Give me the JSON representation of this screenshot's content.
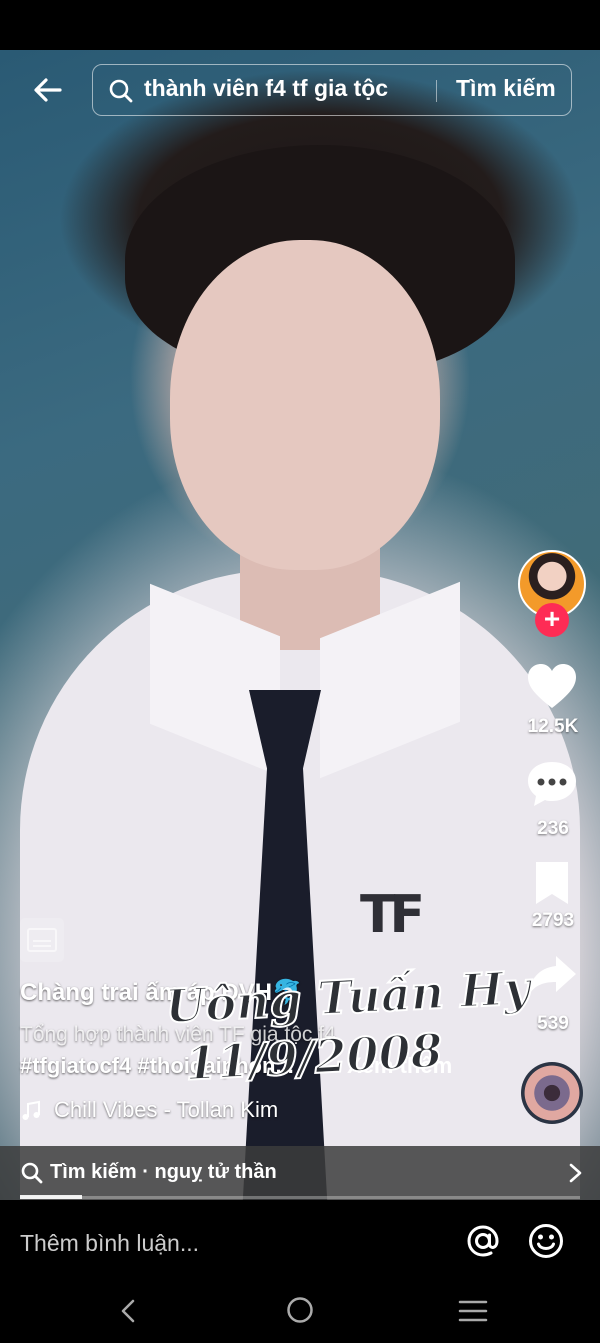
{
  "search": {
    "query": "thành viên f4 tf gia tộc",
    "button_label": "Tìm kiếm"
  },
  "actions": {
    "likes": "12.5K",
    "comments": "236",
    "saves": "2793",
    "shares": "539",
    "follow_symbol": "+"
  },
  "video": {
    "author": "Chàng trai ấm áp DVH🐬",
    "description": "Tổng hợp thành viên TF gia tộc f4",
    "hashtags": "#tfgiatocf4 #thoidaiphon...",
    "more_label": "Xem thêm",
    "music": "Chill Vibes - Tollan Kim",
    "overlay_line1": "Uông Tuấn Hy",
    "overlay_line2": "11/9/2008",
    "badge_text": "TF",
    "progress": 0.11
  },
  "related": {
    "label": "Tìm kiếm · nguỵ tử thần"
  },
  "comment": {
    "placeholder": "Thêm bình luận..."
  },
  "icons": {
    "back": "arrow-left-icon",
    "search": "search-icon",
    "like": "heart-icon",
    "comment": "comment-bubble-icon",
    "save": "bookmark-icon",
    "share": "share-arrow-icon",
    "music": "music-note-icon",
    "mention": "at-icon",
    "emoji": "smiley-icon"
  },
  "colors": {
    "accent": "#fe2c55",
    "background": "#000000",
    "text": "#ffffff"
  }
}
